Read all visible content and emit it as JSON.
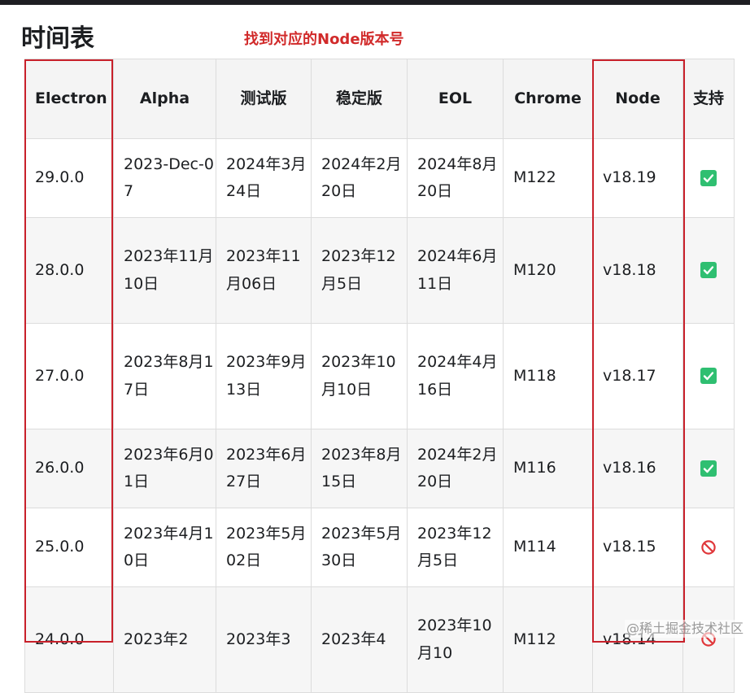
{
  "page": {
    "title": "时间表",
    "annotation": "找到对应的Node版本号",
    "watermark": "@稀土掘金技术社区"
  },
  "colors": {
    "annotation_red": "#c8202a",
    "supported_green": "#2fbf71",
    "unsupported_red": "#e0373a"
  },
  "table": {
    "headers": {
      "electron": "Electron",
      "alpha": "Alpha",
      "beta": "测试版",
      "stable": "稳定版",
      "eol": "EOL",
      "chrome": "Chrome",
      "node": "Node",
      "supported": "支持"
    },
    "rows": [
      {
        "electron": "29.0.0",
        "alpha": "2023-Dec-07",
        "beta": "2024年3月24日",
        "stable": "2024年2月20日",
        "eol": "2024年8月20日",
        "chrome": "M122",
        "node": "v18.19",
        "supported_icon": "check-icon"
      },
      {
        "electron": "28.0.0",
        "alpha": "2023年11月10日",
        "beta": "2023年11月06日",
        "stable": "2023年12月5日",
        "eol": "2024年6月11日",
        "chrome": "M120",
        "node": "v18.18",
        "supported_icon": "check-icon"
      },
      {
        "electron": "27.0.0",
        "alpha": "2023年8月17日",
        "beta": "2023年9月13日",
        "stable": "2023年10月10日",
        "eol": "2024年4月16日",
        "chrome": "M118",
        "node": "v18.17",
        "supported_icon": "check-icon"
      },
      {
        "electron": "26.0.0",
        "alpha": "2023年6月01日",
        "beta": "2023年6月27日",
        "stable": "2023年8月15日",
        "eol": "2024年2月20日",
        "chrome": "M116",
        "node": "v18.16",
        "supported_icon": "check-icon"
      },
      {
        "electron": "25.0.0",
        "alpha": "2023年4月10日",
        "beta": "2023年5月02日",
        "stable": "2023年5月30日",
        "eol": "2023年12月5日",
        "chrome": "M114",
        "node": "v18.15",
        "supported_icon": "prohibited-icon"
      },
      {
        "electron": "24.0.0",
        "alpha": "2023年2",
        "beta": "2023年3",
        "stable": "2023年4",
        "eol": "2023年10月10",
        "chrome": "M112",
        "node": "v18.14",
        "supported_icon": "prohibited-icon"
      }
    ]
  }
}
